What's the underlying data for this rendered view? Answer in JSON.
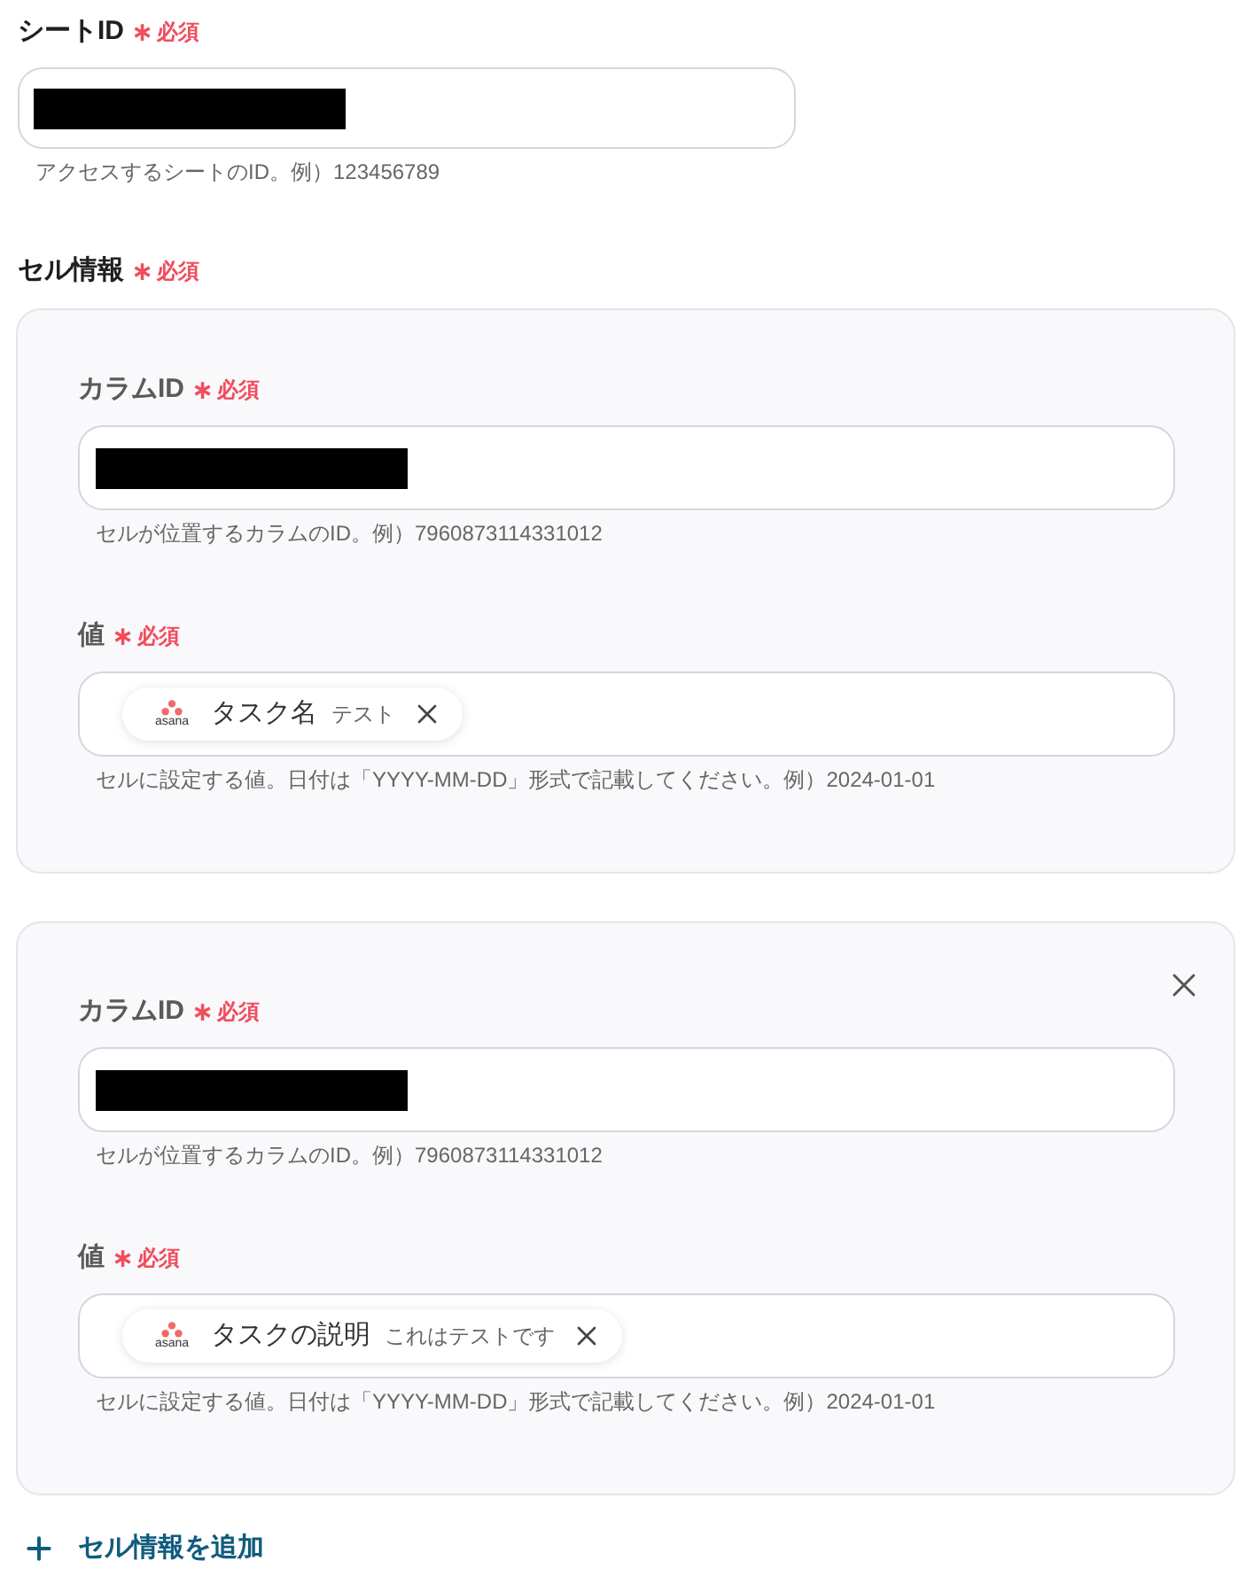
{
  "fields": [
    {
      "kind": "text",
      "label": "シートID",
      "required_mark": "∗",
      "required_text": "必須",
      "redacted": true,
      "help": "アクセスするシートのID。例）123456789"
    }
  ],
  "cell_info": {
    "label": "セル情報",
    "required_mark": "∗",
    "required_text": "必須",
    "entries": [
      {
        "removable": false,
        "fields": [
          {
            "kind": "text",
            "label": "カラムID",
            "required_mark": "∗",
            "required_text": "必須",
            "redacted": true,
            "help": "セルが位置するカラムのID。例）7960873114331012"
          },
          {
            "kind": "tags",
            "label": "値",
            "required_mark": "∗",
            "required_text": "必須",
            "tags": [
              {
                "app": "asana",
                "label": "タスク名",
                "sample": "テスト"
              }
            ],
            "help": "セルに設定する値。日付は「YYYY-MM-DD」形式で記載してください。例）2024-01-01"
          }
        ]
      },
      {
        "removable": true,
        "fields": [
          {
            "kind": "text",
            "label": "カラムID",
            "required_mark": "∗",
            "required_text": "必須",
            "redacted": true,
            "help": "セルが位置するカラムのID。例）7960873114331012"
          },
          {
            "kind": "tags",
            "label": "値",
            "required_mark": "∗",
            "required_text": "必須",
            "tags": [
              {
                "app": "asana",
                "label": "タスクの説明",
                "sample": "これはテストです"
              }
            ],
            "help": "セルに設定する値。日付は「YYYY-MM-DD」形式で記載してください。例）2024-01-01"
          }
        ]
      }
    ]
  },
  "add_button": {
    "label": "セル情報を追加"
  }
}
